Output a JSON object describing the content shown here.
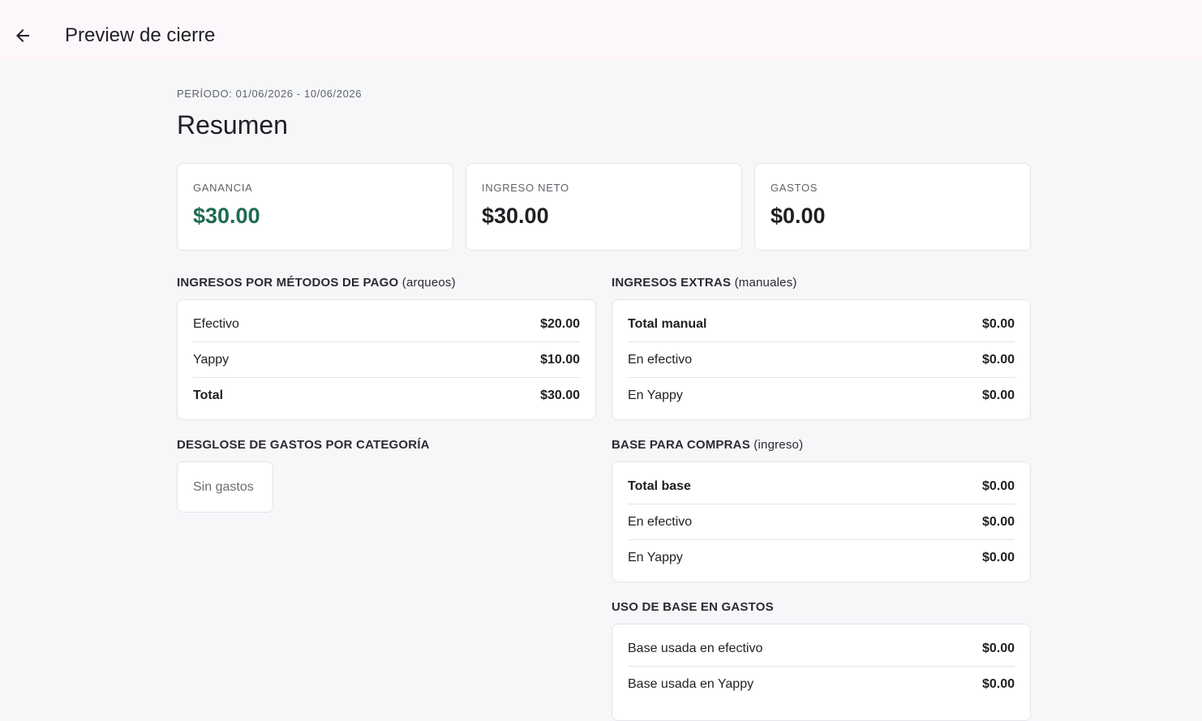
{
  "appbar": {
    "title": "Preview de cierre",
    "back_icon": "arrow-left-icon"
  },
  "header": {
    "periodo": "PERÍODO: 01/06/2026 - 10/06/2026",
    "title": "Resumen"
  },
  "stats": [
    {
      "label": "GANANCIA",
      "value": "$30.00",
      "color": "#1e6b4f"
    },
    {
      "label": "INGRESO NETO",
      "value": "$30.00"
    },
    {
      "label": "GASTOS",
      "value": "$0.00"
    }
  ],
  "metodos_pago": {
    "title": "INGRESOS POR MÉTODOS DE PAGO",
    "suffix": "(arqueos)",
    "rows": [
      {
        "label": "Efectivo",
        "amount": "$20.00"
      },
      {
        "label": "Yappy",
        "amount": "$10.00"
      },
      {
        "label": "Total",
        "amount": "$30.00"
      }
    ]
  },
  "ingresos_extras": {
    "title": "INGRESOS EXTRAS",
    "suffix": "(manuales)",
    "rows": [
      {
        "label": "Total manual",
        "amount": "$0.00"
      },
      {
        "label": "En efectivo",
        "amount": "$0.00"
      },
      {
        "label": "En Yappy",
        "amount": "$0.00"
      }
    ]
  },
  "gastos_categoria": {
    "title": "DESGLOSE DE GASTOS POR CATEGORÍA",
    "empty": "Sin gastos"
  },
  "base_compras": {
    "title": "BASE PARA COMPRAS",
    "suffix": "(ingreso)",
    "rows": [
      {
        "label": "Total base",
        "amount": "$0.00"
      },
      {
        "label": "En efectivo",
        "amount": "$0.00"
      },
      {
        "label": "En Yappy",
        "amount": "$0.00"
      }
    ]
  },
  "uso_base": {
    "title": "USO DE BASE EN GASTOS",
    "rows": [
      {
        "label": "Base usada en efectivo",
        "amount": "$0.00"
      },
      {
        "label": "Base usada en Yappy",
        "amount": "$0.00"
      }
    ]
  }
}
